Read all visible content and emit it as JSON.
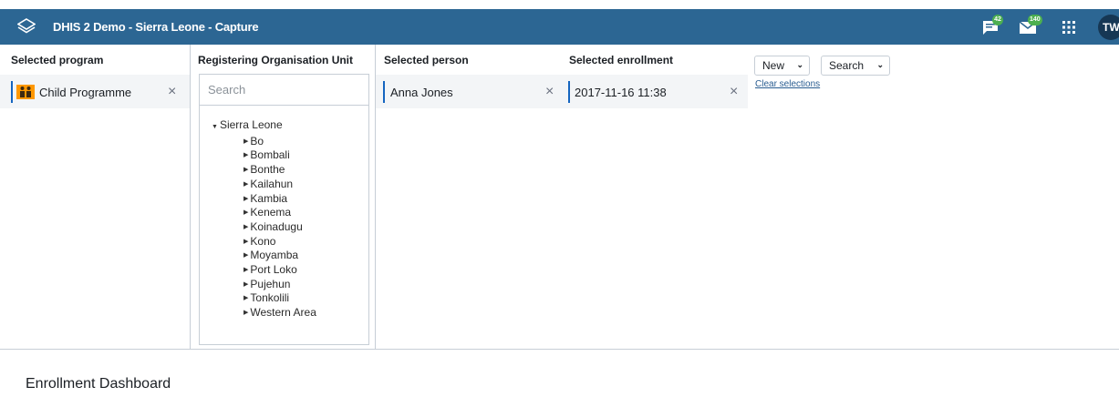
{
  "header": {
    "title": "DHIS 2 Demo - Sierra Leone - Capture",
    "logo_icon": "dhis2-logo-icon",
    "interpretations_badge": "42",
    "messages_badge": "140",
    "apps_icon": "apps-grid-icon",
    "avatar_initials": "TW",
    "bg_color": "#2c6693"
  },
  "program": {
    "label": "Selected program",
    "value": "Child Programme",
    "icon": "people-icon",
    "clear": "×"
  },
  "org_unit": {
    "label": "Registering Organisation Unit",
    "search_placeholder": "Search",
    "root": "Sierra Leone",
    "children": [
      "Bo",
      "Bombali",
      "Bonthe",
      "Kailahun",
      "Kambia",
      "Kenema",
      "Koinadugu",
      "Kono",
      "Moyamba",
      "Port Loko",
      "Pujehun",
      "Tonkolili",
      "Western Area"
    ]
  },
  "person": {
    "label": "Selected person",
    "value": "Anna Jones",
    "clear": "×"
  },
  "enrollment": {
    "label": "Selected enrollment",
    "value": "2017-11-16 11:38",
    "clear": "×"
  },
  "actions": {
    "new_label": "New",
    "search_label": "Search",
    "clear_selections": "Clear selections"
  },
  "dashboard": {
    "title": "Enrollment Dashboard"
  }
}
